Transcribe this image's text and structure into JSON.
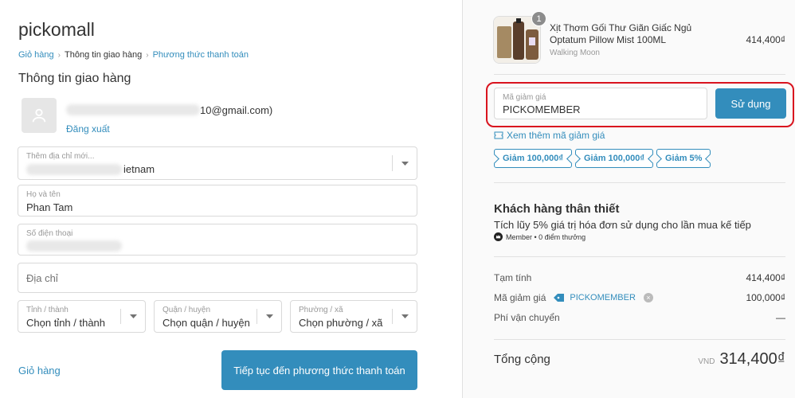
{
  "brand": "pickomall",
  "breadcrumb": {
    "cart": "Giỏ hàng",
    "shipping_info": "Thông tin giao hàng",
    "payment": "Phương thức thanh toán"
  },
  "section_title": "Thông tin giao hàng",
  "user": {
    "email_visible": "10@gmail.com)",
    "logout": "Đăng xuất"
  },
  "address_select": {
    "label": "Thêm địa chỉ mới...",
    "value": "ietnam"
  },
  "fullname": {
    "label": "Họ và tên",
    "value": "Phan Tam"
  },
  "phone": {
    "label": "Số điện thoại"
  },
  "address": {
    "placeholder": "Địa chỉ"
  },
  "province": {
    "label": "Tỉnh / thành",
    "value": "Chọn tỉnh / thành"
  },
  "district": {
    "label": "Quận / huyện",
    "value": "Chọn quận / huyện"
  },
  "ward": {
    "label": "Phường / xã",
    "value": "Chọn phường / xã"
  },
  "footer": {
    "back_to_cart": "Giỏ hàng",
    "continue": "Tiếp tục đến phương thức thanh toán"
  },
  "product": {
    "quantity": "1",
    "name": "Xịt Thơm Gối Thư Giãn Giấc Ngủ Optatum Pillow Mist 100ML",
    "vendor": "Walking Moon",
    "price": "414,400₫"
  },
  "coupon": {
    "label": "Mã giảm giá",
    "value": "PICKOMEMBER",
    "apply": "Sử dụng",
    "more": "Xem thêm mã giảm giá",
    "chips": [
      "Giảm 100,000₫",
      "Giảm 100,000₫",
      "Giảm 5%"
    ]
  },
  "loyalty": {
    "title": "Khách hàng thân thiết",
    "desc": "Tích lũy 5% giá trị hóa đơn sử dụng cho lần mua kế tiếp",
    "member": "Member • 0 điểm thưởng"
  },
  "summary": {
    "subtotal_label": "Tạm tính",
    "subtotal": "414,400₫",
    "discount_label": "Mã giảm giá",
    "discount_code": "PICKOMEMBER",
    "discount": "100,000₫",
    "shipping_label": "Phí vận chuyển",
    "shipping": "—",
    "total_label": "Tổng cộng",
    "currency": "VND",
    "total": "314,400₫"
  },
  "colors": {
    "accent": "#338dbc",
    "highlight": "#d9131e"
  }
}
